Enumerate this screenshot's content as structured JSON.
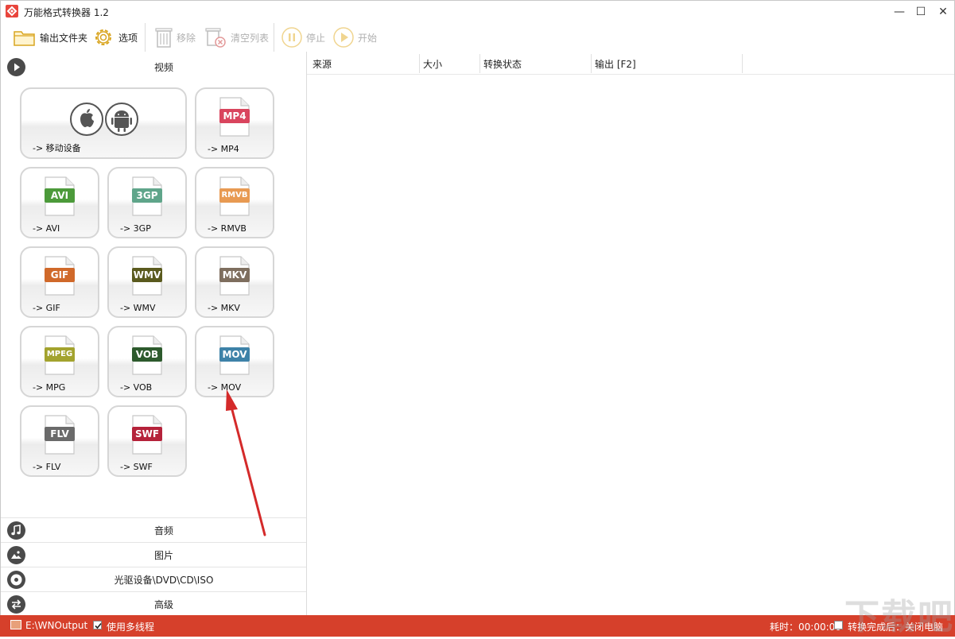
{
  "window": {
    "title": "万能格式转换器 1.2"
  },
  "title_controls": {
    "minimize": "—",
    "maximize": "☐",
    "close": "✕"
  },
  "toolbar": {
    "output_folder": "输出文件夹",
    "options": "选项",
    "remove": "移除",
    "clear_list": "清空列表",
    "stop": "停止",
    "start": "开始"
  },
  "categories": {
    "video": "视频",
    "audio": "音频",
    "image": "图片",
    "disc": "光驱设备\\DVD\\CD\\ISO",
    "advanced": "高级"
  },
  "tiles": {
    "mobile": {
      "label": "-> 移动设备"
    },
    "mp4": {
      "badge": "MP4",
      "label": "-> MP4",
      "color": "#d9455e"
    },
    "avi": {
      "badge": "AVI",
      "label": "-> AVI",
      "color": "#4c9a3a"
    },
    "3gp": {
      "badge": "3GP",
      "label": "-> 3GP",
      "color": "#5fa58a"
    },
    "rmvb": {
      "badge": "RMVB",
      "label": "-> RMVB",
      "color": "#e89a52"
    },
    "gif": {
      "badge": "GIF",
      "label": "-> GIF",
      "color": "#d0692a"
    },
    "wmv": {
      "badge": "WMV",
      "label": "-> WMV",
      "color": "#5a5a1e"
    },
    "mkv": {
      "badge": "MKV",
      "label": "-> MKV",
      "color": "#7e6e5e"
    },
    "mpg": {
      "badge": "MPEG",
      "label": "-> MPG",
      "color": "#a3a32e"
    },
    "vob": {
      "badge": "VOB",
      "label": "-> VOB",
      "color": "#2d5a2d"
    },
    "mov": {
      "badge": "MOV",
      "label": "-> MOV",
      "color": "#3e82a8"
    },
    "flv": {
      "badge": "FLV",
      "label": "-> FLV",
      "color": "#6a6a6a"
    },
    "swf": {
      "badge": "SWF",
      "label": "-> SWF",
      "color": "#b5223a"
    }
  },
  "list": {
    "columns": [
      "来源",
      "大小",
      "转换状态",
      "输出 [F2]"
    ]
  },
  "status": {
    "output_path": "E:\\WNOutput",
    "multithread_label": "使用多线程",
    "multithread_checked": true,
    "elapsed_label": "耗时：00:00:00",
    "shutdown_label": "转换完成后：关闭电脑",
    "shutdown_checked": false
  },
  "colors": {
    "accent": "#d6402b",
    "annotation_arrow": "#d42a2a"
  },
  "watermark": "下载吧"
}
